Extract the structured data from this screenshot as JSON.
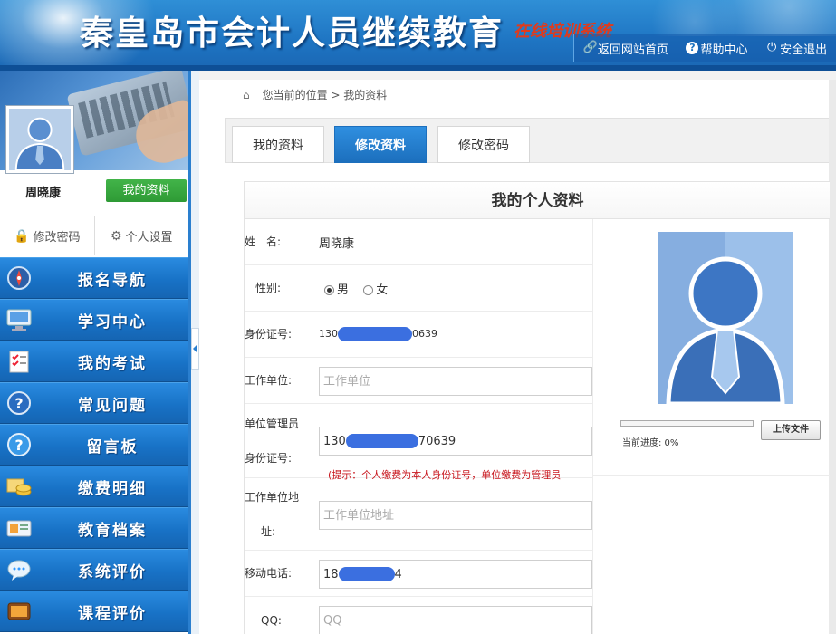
{
  "header": {
    "site_title": "秦皇岛市会计人员继续教育",
    "subtitle": "在线培训系统",
    "links": [
      {
        "label": "返回网站首页",
        "icon": "link-icon"
      },
      {
        "label": "帮助中心",
        "icon": "help-icon"
      },
      {
        "label": "安全退出",
        "icon": "power-icon"
      }
    ]
  },
  "sidebar": {
    "user_name": "周晓康",
    "my_profile_label": "我的资料",
    "change_password_label": "修改密码",
    "personal_settings_label": "个人设置",
    "nav": [
      {
        "label": "报名导航",
        "icon": "compass-icon"
      },
      {
        "label": "学习中心",
        "icon": "monitor-icon"
      },
      {
        "label": "我的考试",
        "icon": "checklist-icon"
      },
      {
        "label": "常见问题",
        "icon": "question-icon"
      },
      {
        "label": "留言板",
        "icon": "message-question-icon"
      },
      {
        "label": "缴费明细",
        "icon": "coins-icon"
      },
      {
        "label": "教育档案",
        "icon": "id-card-icon"
      },
      {
        "label": "系统评价",
        "icon": "chat-bubble-icon"
      },
      {
        "label": "课程评价",
        "icon": "tv-icon"
      }
    ]
  },
  "breadcrumb": {
    "text": "您当前的位置 > 我的资料"
  },
  "tabs": [
    {
      "label": "我的资料",
      "active": false
    },
    {
      "label": "修改资料",
      "active": true
    },
    {
      "label": "修改密码",
      "active": false
    }
  ],
  "form": {
    "title": "我的个人资料",
    "name_label": "姓　名:",
    "name_value": "周晓康",
    "gender_label": "性别:",
    "gender_male": "男",
    "gender_female": "女",
    "gender_selected": "男",
    "id_label": "身份证号:",
    "id_prefix": "130",
    "id_suffix": "0639",
    "workplace_label": "工作单位:",
    "workplace_placeholder": "工作单位",
    "admin_id_label_1": "单位管理员",
    "admin_id_label_2": "身份证号:",
    "admin_id_prefix": "130",
    "admin_id_suffix": "70639",
    "hint": "(提示：个人缴费为本人身份证号，单位缴费为管理员",
    "address_label_1": "工作单位地",
    "address_label_2": "址:",
    "address_placeholder": "工作单位地址",
    "phone_label": "移动电话:",
    "phone_prefix": "18",
    "phone_suffix": "4",
    "qq_label": "QQ:",
    "qq_placeholder": "QQ"
  },
  "photo": {
    "upload_label": "上传文件",
    "progress_text": "当前进度: 0%",
    "progress": 0
  },
  "colors": {
    "header_blue": "#1e74c2",
    "nav_blue": "#1872c6",
    "green": "#2e9a35",
    "hint_red": "#c8171e"
  }
}
